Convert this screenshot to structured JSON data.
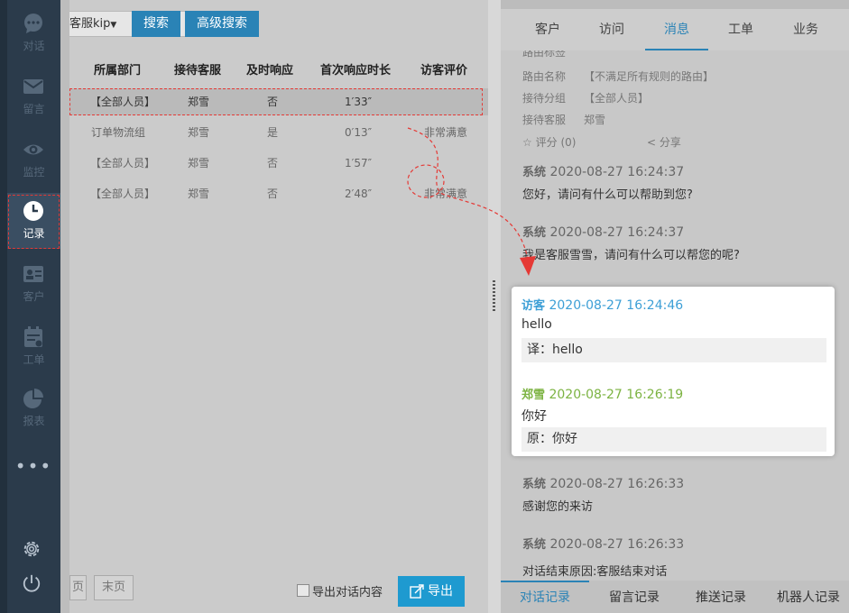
{
  "sidebar": {
    "items": [
      {
        "label": "对话",
        "icon": "chat-bubble-icon"
      },
      {
        "label": "留言",
        "icon": "envelope-icon"
      },
      {
        "label": "监控",
        "icon": "eye-icon"
      },
      {
        "label": "记录",
        "icon": "clock-icon",
        "active": true
      },
      {
        "label": "客户",
        "icon": "contact-card-icon"
      },
      {
        "label": "工单",
        "icon": "calendar-ticket-icon"
      },
      {
        "label": "报表",
        "icon": "pie-chart-icon"
      }
    ],
    "more": "•••",
    "bottom_icons": [
      "gear-icon",
      "power-icon"
    ]
  },
  "toolbar": {
    "select_value": "客服kip",
    "search_label": "搜索",
    "advanced_search_label": "高级搜索"
  },
  "table": {
    "headers": [
      "所属部门",
      "接待客服",
      "及时响应",
      "首次响应时长",
      "访客评价"
    ],
    "rows": [
      [
        "【全部人员】",
        "郑雪",
        "否",
        "1′33″",
        ""
      ],
      [
        "订单物流组",
        "郑雪",
        "是",
        "0′13″",
        "非常满意"
      ],
      [
        "【全部人员】",
        "郑雪",
        "否",
        "1′57″",
        ""
      ],
      [
        "【全部人员】",
        "郑雪",
        "否",
        "2′48″",
        "非常满意"
      ]
    ],
    "selected_row": 0
  },
  "pager": {
    "prev_label": "页",
    "last_label": "末页"
  },
  "export": {
    "checkbox_label": "导出对话内容",
    "button_label": "导出"
  },
  "right_tabs": {
    "items": [
      "客户",
      "访问",
      "消息",
      "工单",
      "业务"
    ],
    "active": 2
  },
  "info": {
    "partial_label": "路由标签",
    "rows": [
      {
        "label": "路由名称",
        "value": "【不满足所有规则的路由】"
      },
      {
        "label": "接待分组",
        "value": "【全部人员】"
      },
      {
        "label": "接待客服",
        "value": "郑雪"
      }
    ],
    "rating_label": "评分",
    "rating_value": "(0)",
    "share_label": "分享"
  },
  "messages": [
    {
      "sender": "系统",
      "time": "2020-08-27 16:24:37",
      "text": "您好，请问有什么可以帮助到您?"
    },
    {
      "sender": "系统",
      "time": "2020-08-27 16:24:37",
      "text": "我是客服雪雪，请问有什么可以帮您的呢?"
    }
  ],
  "highlight": {
    "visitor": {
      "sender": "访客",
      "time": "2020-08-27 16:24:46",
      "text": "hello",
      "translation": "译：hello"
    },
    "agent": {
      "sender": "郑雪",
      "time": "2020-08-27 16:26:19",
      "text": "你好",
      "original": "原：你好"
    }
  },
  "messages_after": [
    {
      "sender": "系统",
      "time": "2020-08-27 16:26:33",
      "text": "感谢您的来访"
    },
    {
      "sender": "系统",
      "time": "2020-08-27 16:26:33",
      "text": "对话结束原因:客服结束对话"
    }
  ],
  "bottom_tabs": {
    "items": [
      "对话记录",
      "留言记录",
      "推送记录",
      "机器人记录"
    ],
    "active": 0
  },
  "colors": {
    "accent": "#2a83b6",
    "visitor": "#3d9fd6",
    "agent": "#7cb342",
    "annotation": "#e53935"
  }
}
